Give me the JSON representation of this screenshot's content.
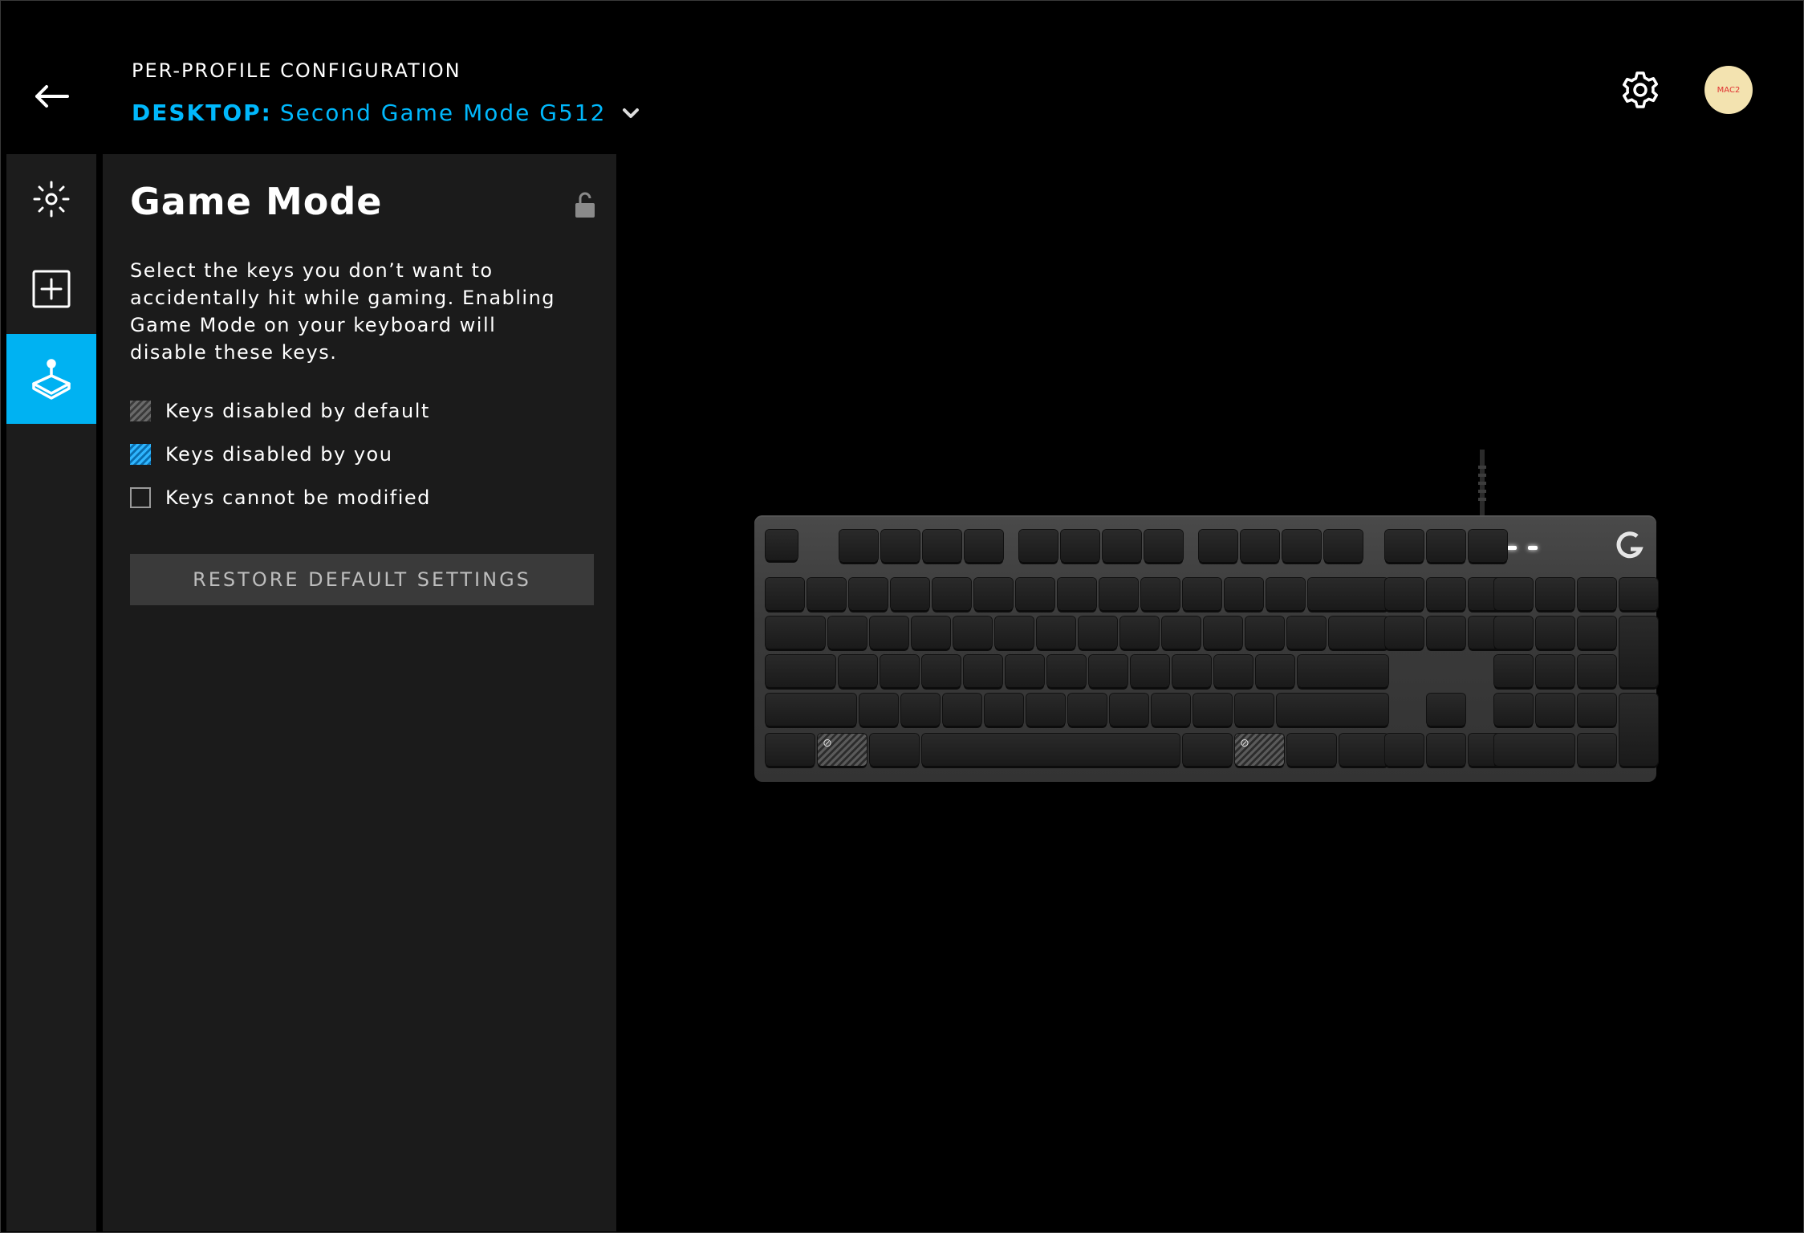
{
  "header": {
    "config_label": "PER-PROFILE CONFIGURATION",
    "profile_prefix": "DESKTOP:",
    "profile_name": "Second Game Mode G512",
    "avatar_text": "MAC2"
  },
  "sidebar": {
    "items": [
      {
        "name": "lighting",
        "icon": "sun-icon",
        "active": false
      },
      {
        "name": "assignments",
        "icon": "plus-square-icon",
        "active": false
      },
      {
        "name": "game-mode",
        "icon": "joystick-icon",
        "active": true
      }
    ]
  },
  "panel": {
    "title": "Game Mode",
    "description": "Select the keys you don’t want to accidentally hit while gaming. Enabling Game Mode on your keyboard will disable these keys.",
    "legend": [
      {
        "label": "Keys disabled by default",
        "swatch": "default"
      },
      {
        "label": "Keys disabled by you",
        "swatch": "user"
      },
      {
        "label": "Keys cannot be modified",
        "swatch": "fixed"
      }
    ],
    "restore_label": "RESTORE DEFAULT SETTINGS"
  },
  "keyboard": {
    "model": "G512",
    "disabled_by_default": [
      "Left Win",
      "Right Win"
    ]
  },
  "colors": {
    "accent": "#00b8fc",
    "active_tab": "#00b2f2",
    "panel_bg": "#1b1b1b",
    "button_bg": "#3a3a3a"
  }
}
